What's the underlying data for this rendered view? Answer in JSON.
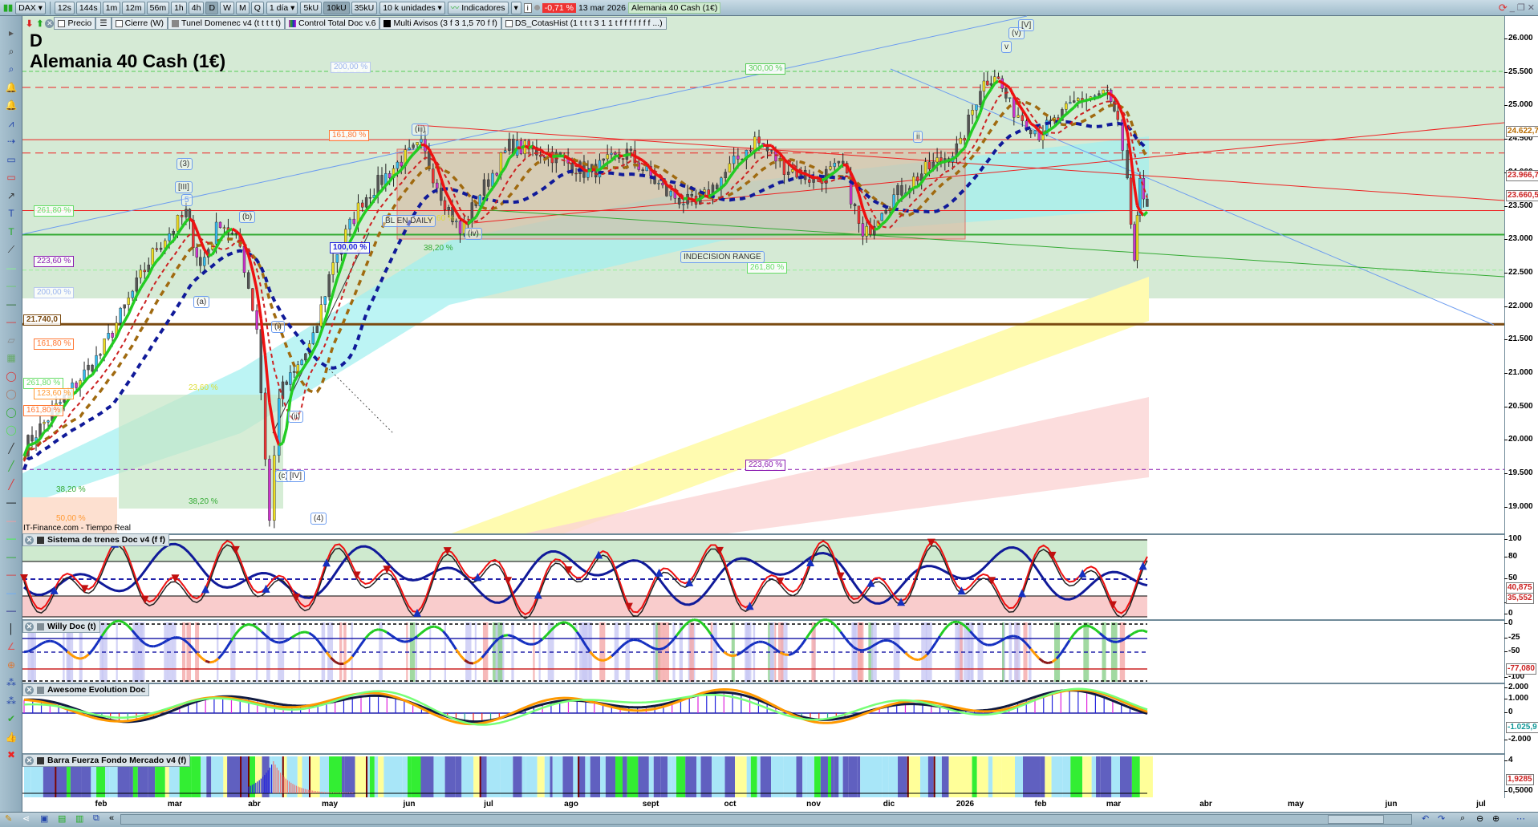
{
  "toolbar": {
    "symbol": "DAX",
    "timeframes": [
      "12s",
      "144s",
      "1m",
      "12m",
      "56m",
      "1h",
      "4h",
      "D",
      "W",
      "M",
      "Q"
    ],
    "selected_timeframe": "D",
    "period": "1 día",
    "units": [
      "5kU",
      "10kU",
      "35kU"
    ],
    "selected_unit": "10kU",
    "units_select": "10 k unidades",
    "indicators": "Indicadores",
    "change": "-0,71 %",
    "date": "13 mar 2026",
    "instrument": "Alemania 40 Cash (1€)"
  },
  "legend": {
    "items": [
      "Precio",
      "Cierre (W)",
      "Tunel Domenec v4 (t t t t t)",
      "Control Total Doc v.6",
      "Multi Avisos (3 f 3 1,5 70 f f)",
      "DS_CotasHist (1 t t t 3 1 1 t f f f f f f f ...)"
    ]
  },
  "chart": {
    "period_letter": "D",
    "title": "Alemania 40 Cash (1€)",
    "source": "IT-Finance.com - Tiempo Real",
    "fib_labels": [
      "200,00 %",
      "300,00 %",
      "161,80 %",
      "261,80 %",
      "223,60 %",
      "200,00 %",
      "21.740,0",
      "161,80 %",
      "261,80 %",
      "123,60 %",
      "161,80 %",
      "100,00 %",
      "23,60 %",
      "38,20 %",
      "50,00 %",
      "38,20 %",
      "38,20 %",
      "261,80 %",
      "223,60 %",
      "23,60 %"
    ],
    "annotations": {
      "bl": "BL EN DAILY",
      "range": "INDECISION RANGE"
    },
    "waves": [
      "(3)",
      "[III]",
      "5",
      "(b)",
      "(a)",
      "(i)",
      "(ii)",
      "(c)",
      "[IV]",
      "(4)",
      "(iii)",
      "(iv)",
      "v",
      "(v)",
      "[V]",
      "ii"
    ]
  },
  "price_axis": {
    "ticks": [
      "26.000",
      "25.500",
      "25.000",
      "24.500",
      "24.000",
      "23.500",
      "23.000",
      "22.500",
      "22.000",
      "21.500",
      "21.000",
      "20.500",
      "20.000",
      "19.500",
      "19.000"
    ],
    "markers": [
      "24.622,7",
      "23.966,7",
      "23.660,5"
    ]
  },
  "panels": [
    {
      "title": "Sistema de trenes Doc v4 (f f)",
      "ticks": [
        "100",
        "80",
        "50",
        "20",
        "0"
      ],
      "markers": [
        "40,875",
        "35,552"
      ]
    },
    {
      "title": "Willy Doc (t)",
      "ticks": [
        "0",
        "-25",
        "-50",
        "-100"
      ],
      "markers": [
        "-77,080"
      ]
    },
    {
      "title": "Awesome Evolution Doc",
      "ticks": [
        "2.000",
        "1.000",
        "0",
        "-2.000"
      ],
      "markers": [
        "-1.025,9"
      ]
    },
    {
      "title": "Barra Fuerza Fondo Mercado v4 (f)",
      "ticks": [
        "4",
        "0,5000"
      ],
      "markers": [
        "1,9285"
      ]
    }
  ],
  "date_axis": [
    "feb",
    "mar",
    "abr",
    "may",
    "jun",
    "jul",
    "ago",
    "sept",
    "oct",
    "nov",
    "dic",
    "2026",
    "feb",
    "mar",
    "abr",
    "may",
    "jun",
    "jul"
  ],
  "colors": {
    "bull": "#22cc22",
    "bear": "#ee1111",
    "ma_blue": "#101a99",
    "ma_brown": "#a06a10",
    "bg_zone": "#d5ead5",
    "support": "#7a4a10"
  },
  "chart_data": {
    "type": "line",
    "title": "Alemania 40 Cash (1€)",
    "x_unit": "months since Jan 2025",
    "ylim": [
      18700,
      26300
    ],
    "price_path": [
      [
        0,
        19900
      ],
      [
        0.96,
        21300
      ],
      [
        1.67,
        22900
      ],
      [
        2.04,
        23400
      ],
      [
        2.22,
        22600
      ],
      [
        2.47,
        23300
      ],
      [
        2.72,
        22900
      ],
      [
        2.93,
        21700
      ],
      [
        3.09,
        18800
      ],
      [
        3.21,
        20700
      ],
      [
        3.4,
        21000
      ],
      [
        3.64,
        21500
      ],
      [
        3.89,
        22700
      ],
      [
        4.26,
        23600
      ],
      [
        4.75,
        24200
      ],
      [
        5.0,
        24400
      ],
      [
        5.25,
        23700
      ],
      [
        5.49,
        23100
      ],
      [
        5.74,
        23700
      ],
      [
        6.11,
        24400
      ],
      [
        6.6,
        24300
      ],
      [
        7.1,
        24000
      ],
      [
        7.59,
        24300
      ],
      [
        8.09,
        23700
      ],
      [
        8.46,
        23500
      ],
      [
        8.83,
        24000
      ],
      [
        9.2,
        24500
      ],
      [
        9.57,
        24100
      ],
      [
        9.94,
        23900
      ],
      [
        10.31,
        24100
      ],
      [
        10.56,
        23000
      ],
      [
        10.8,
        23500
      ],
      [
        11.3,
        24000
      ],
      [
        11.79,
        24400
      ],
      [
        12.04,
        25300
      ],
      [
        12.22,
        25500
      ],
      [
        12.41,
        25000
      ],
      [
        12.78,
        24600
      ],
      [
        13.02,
        24800
      ],
      [
        13.27,
        25100
      ],
      [
        13.64,
        25200
      ],
      [
        13.77,
        24700
      ],
      [
        13.89,
        23800
      ],
      [
        13.98,
        22700
      ],
      [
        14.05,
        23800
      ],
      [
        14.14,
        23500
      ]
    ]
  }
}
